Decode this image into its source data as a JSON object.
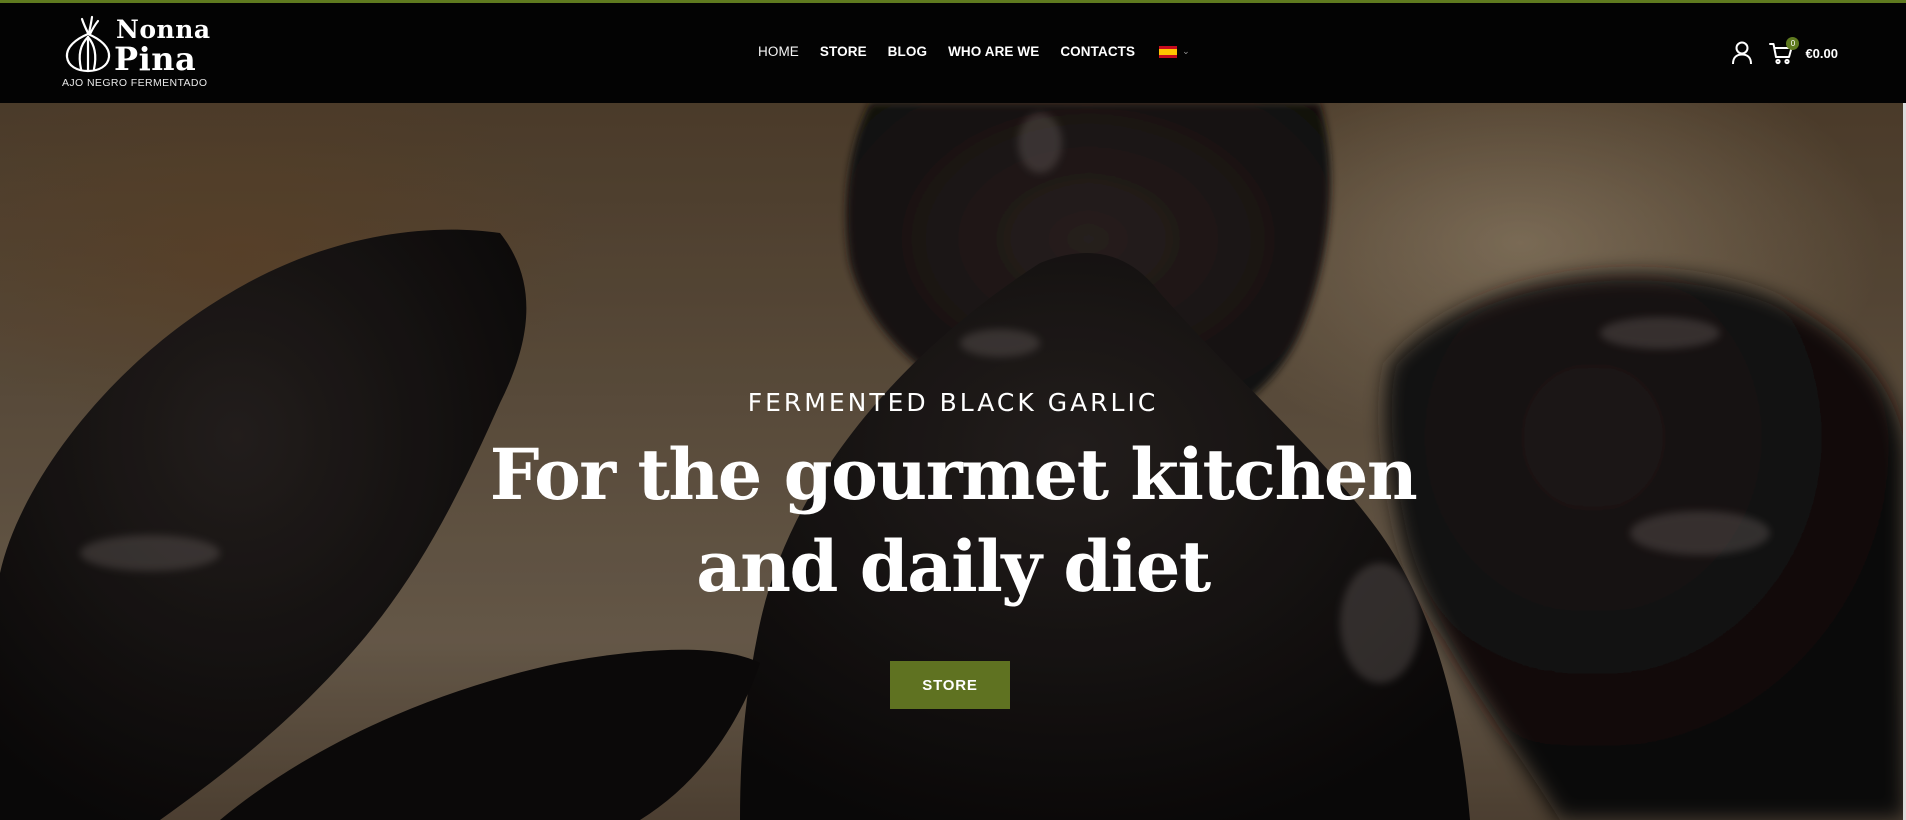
{
  "colors": {
    "accent": "#5f7a1f",
    "header_bg": "#030303",
    "button_bg": "#5f7221",
    "text_light": "#ffffff"
  },
  "logo": {
    "line1": "Nonna",
    "line2": "Pina",
    "tagline": "AJO NEGRO FERMENTADO",
    "icon": "garlic-icon"
  },
  "nav": {
    "items": [
      {
        "label": "HOME",
        "active": true
      },
      {
        "label": "STORE"
      },
      {
        "label": "BLOG"
      },
      {
        "label": "WHO ARE WE"
      },
      {
        "label": "CONTACTS"
      }
    ],
    "language": {
      "flag": "spain-flag-icon",
      "chevron": "chevron-down-icon",
      "chevron_glyph": "⌄"
    }
  },
  "header_actions": {
    "account_icon": "user-icon",
    "cart_icon": "cart-icon",
    "cart_count": "0",
    "cart_total": "€0.00"
  },
  "hero": {
    "eyebrow": "FERMENTED BLACK GARLIC",
    "headline_line1": "For the gourmet kitchen",
    "headline_line2": "and daily diet",
    "button_label": "STORE"
  }
}
